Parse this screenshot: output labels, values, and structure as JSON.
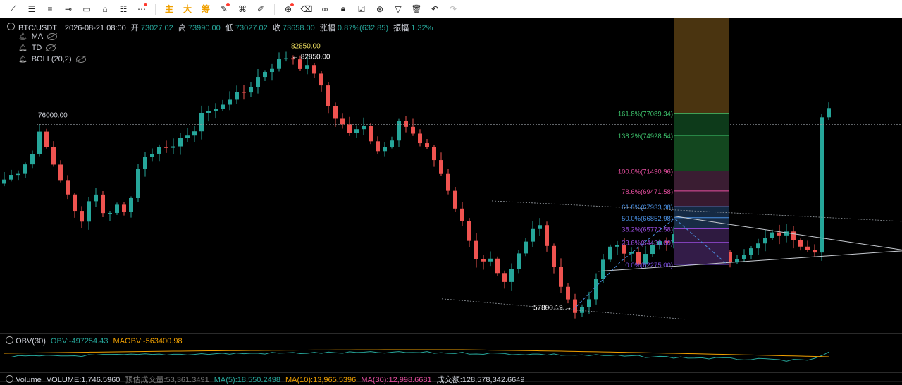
{
  "header": {
    "symbol": "BTC/USDT",
    "datetime": "2026-08-21 08:00",
    "open_label": "开",
    "open": "73027.02",
    "high_label": "高",
    "high": "73990.00",
    "low_label": "低",
    "low": "73027.02",
    "close_label": "收",
    "close": "73658.00",
    "change_label": "涨幅",
    "change": "0.87%(632.85)",
    "amp_label": "振幅",
    "amp": "1.32%"
  },
  "indicators": [
    {
      "label": "MA"
    },
    {
      "label": "TD"
    },
    {
      "label": "BOLL(20,2)"
    }
  ],
  "toolbar": {
    "text_tools": [
      "主",
      "大",
      "筹"
    ],
    "icons": [
      "trend-line-icon",
      "horizontal-lines-icon",
      "parallel-channel-icon",
      "horizontal-ray-icon",
      "rectangle-icon",
      "pattern-icon",
      "fib-icon",
      "path-icon",
      "brush-icon",
      "magnet-icon",
      "pencil-icon",
      "zoom-icon",
      "eraser-icon",
      "link-icon",
      "lock-icon",
      "note-icon",
      "measure-icon",
      "filter-icon",
      "trash-icon",
      "undo-icon",
      "redo-icon"
    ]
  },
  "obv": {
    "name": "OBV(30)",
    "obv": "OBV:-497254.43",
    "maobv": "MAOBV:-563400.98",
    "obv_color": "#26a69a",
    "maobv_color": "#f0a000"
  },
  "volume": {
    "name": "Volume",
    "volume": "VOLUME:1,746.5960",
    "est": "预估成交量:53,361.3491",
    "ma5": "MA(5):18,550.2498",
    "ma10": "MA(10):13,965.5396",
    "ma30": "MA(30):12,998.6681",
    "amount": "成交额:128,578,342.6649"
  },
  "colors": {
    "up": "#26a69a",
    "down": "#ef5350",
    "fib_orange": "#f0a000"
  },
  "chart_data": {
    "type": "candlestick",
    "xlabel": "",
    "ylabel": "",
    "ylim": [
      55500,
      86400
    ],
    "candle_count": 118,
    "annotations": {
      "high_label": "82850.00",
      "high_marker": "82850.00",
      "low_marker": "57800.19",
      "level_label": "76000.00"
    },
    "fib_levels": [
      {
        "label": "161.8%(77089.34)",
        "value": 77089.34,
        "color": "#3ec46d"
      },
      {
        "label": "138.2%(74928.54)",
        "value": 74928.54,
        "color": "#3ec46d"
      },
      {
        "label": "100.0%(71430.96)",
        "value": 71430.96,
        "color": "#e64fa0"
      },
      {
        "label": "78.6%(69471.58)",
        "value": 69471.58,
        "color": "#e64fa0"
      },
      {
        "label": "61.8%(67933.38)",
        "value": 67933.38,
        "color": "#4a90e2"
      },
      {
        "label": "50.0%(66852.98)",
        "value": 66852.98,
        "color": "#4a90e2"
      },
      {
        "label": "38.2%(65772.58)",
        "value": 65772.58,
        "color": "#9b4de0"
      },
      {
        "label": "23.6%(64436.00)",
        "value": 64436.0,
        "color": "#9b4de0"
      },
      {
        "label": "0.0%(62275.00)",
        "value": 62275.0,
        "color": "#7b4de0"
      }
    ],
    "path": [
      [
        0,
        70600
      ],
      [
        4,
        71300
      ],
      [
        9,
        73100
      ],
      [
        12,
        75900
      ],
      [
        16,
        71600
      ],
      [
        20,
        69500
      ],
      [
        25,
        66200
      ],
      [
        29,
        70000
      ],
      [
        32,
        67100
      ],
      [
        36,
        68000
      ],
      [
        40,
        67600
      ],
      [
        44,
        72800
      ],
      [
        48,
        73600
      ],
      [
        52,
        73200
      ],
      [
        56,
        74800
      ],
      [
        60,
        74400
      ],
      [
        63,
        77200
      ],
      [
        68,
        77300
      ],
      [
        72,
        78700
      ],
      [
        76,
        78800
      ],
      [
        80,
        80100
      ],
      [
        84,
        81300
      ],
      [
        88,
        82100
      ],
      [
        92,
        82850
      ],
      [
        96,
        81600
      ],
      [
        100,
        81200
      ],
      [
        104,
        78000
      ],
      [
        108,
        76200
      ],
      [
        112,
        75000
      ],
      [
        116,
        75800
      ],
      [
        120,
        73600
      ],
      [
        124,
        74000
      ],
      [
        127,
        76800
      ],
      [
        130,
        75600
      ],
      [
        134,
        74000
      ],
      [
        139,
        72500
      ],
      [
        145,
        68000
      ],
      [
        150,
        64500
      ],
      [
        153,
        62100
      ],
      [
        156,
        63600
      ],
      [
        160,
        60300
      ],
      [
        164,
        62300
      ],
      [
        168,
        64200
      ],
      [
        172,
        66200
      ],
      [
        176,
        62700
      ],
      [
        180,
        59400
      ],
      [
        184,
        57900
      ],
      [
        188,
        58600
      ],
      [
        192,
        62400
      ],
      [
        196,
        64200
      ],
      [
        200,
        63500
      ],
      [
        204,
        62600
      ],
      [
        208,
        63900
      ],
      [
        212,
        64800
      ],
      [
        216,
        64800
      ],
      [
        221,
        65500
      ],
      [
        225,
        64100
      ],
      [
        229,
        64300
      ],
      [
        233,
        62500
      ],
      [
        237,
        63400
      ],
      [
        241,
        63700
      ],
      [
        246,
        64900
      ],
      [
        250,
        65400
      ],
      [
        254,
        65000
      ],
      [
        258,
        64100
      ],
      [
        262,
        63800
      ],
      [
        266,
        77600
      ]
    ]
  }
}
